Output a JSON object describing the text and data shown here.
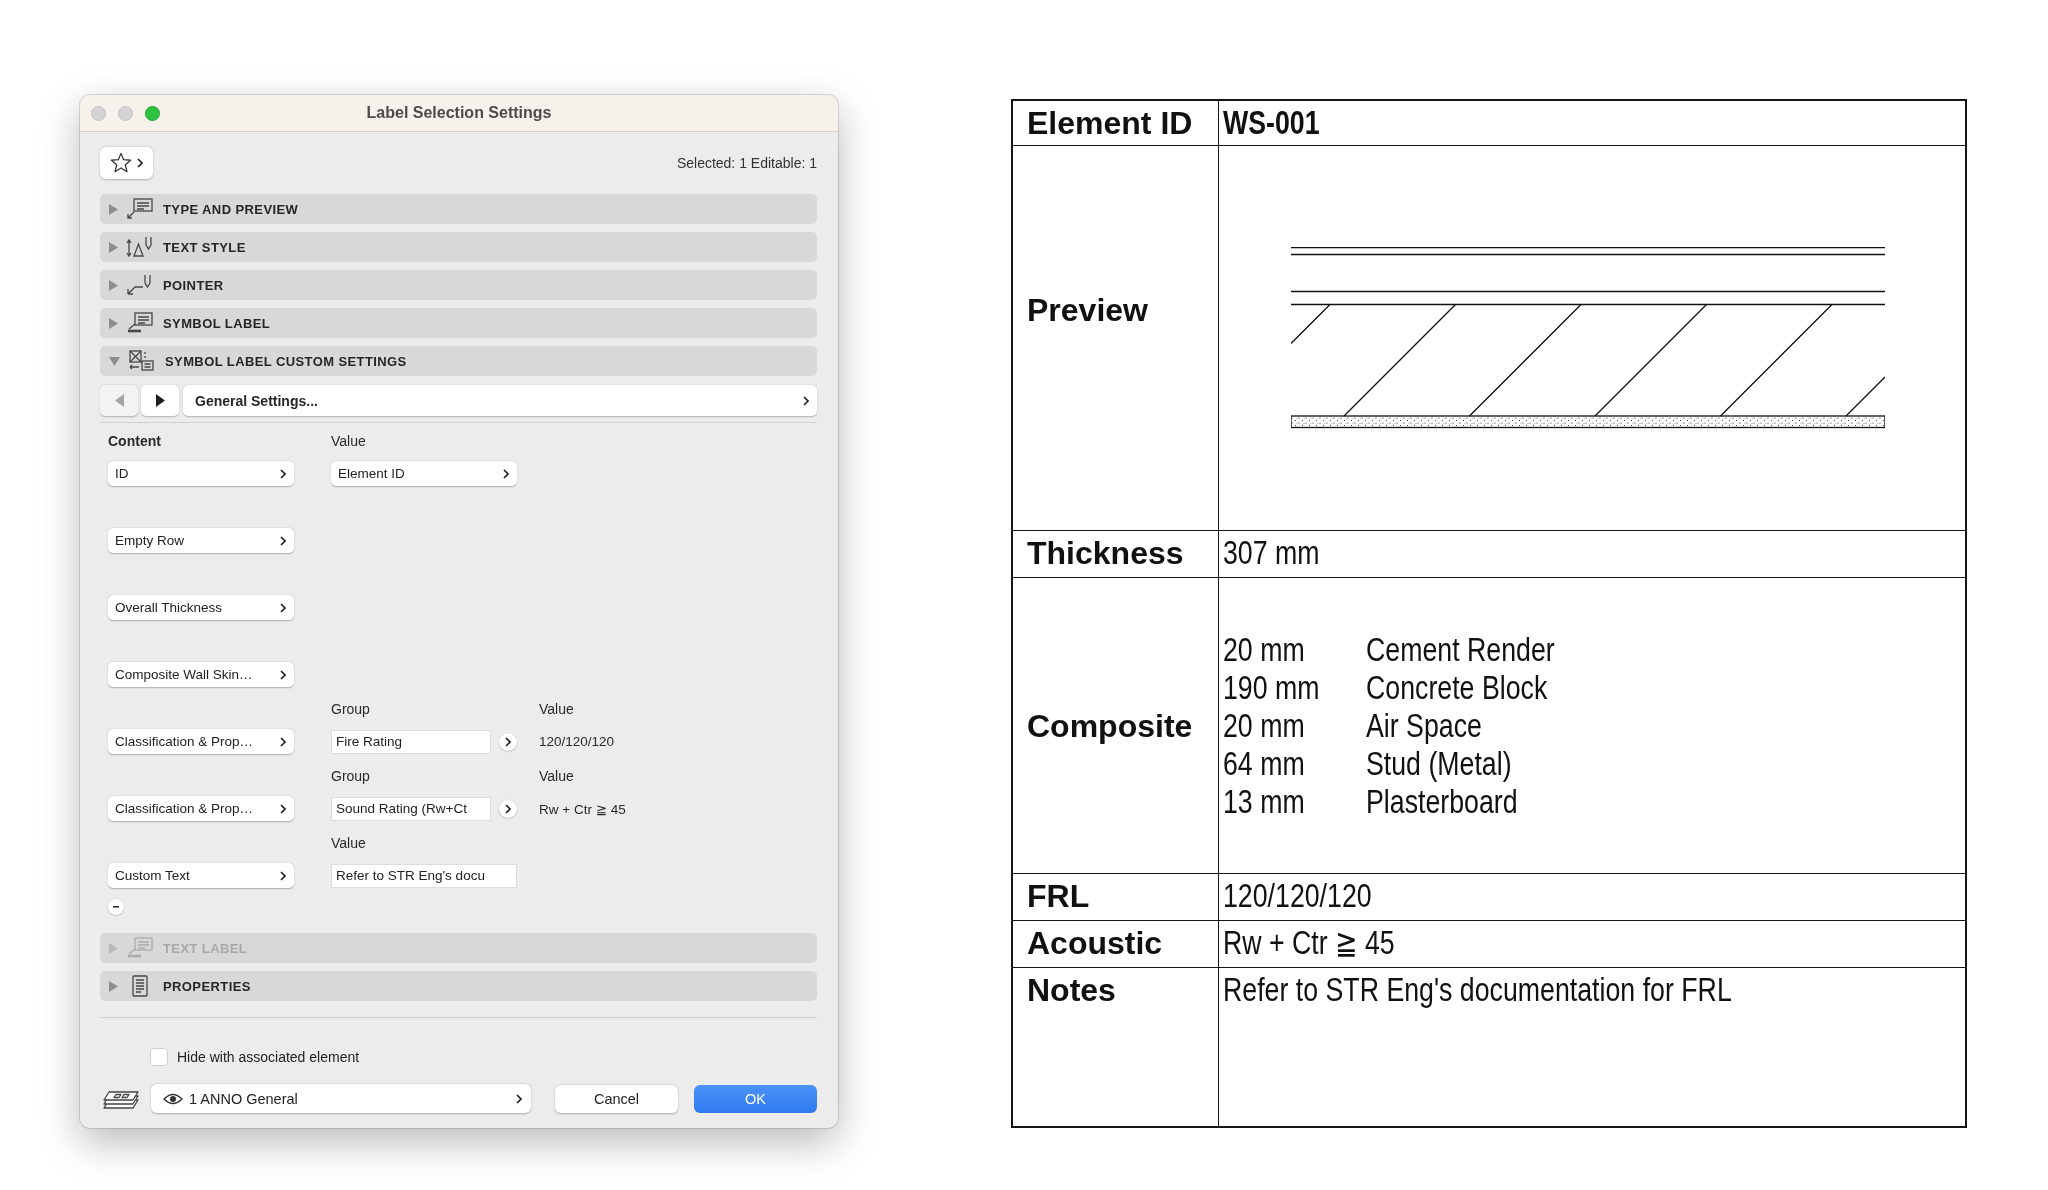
{
  "dialog": {
    "title": "Label Selection Settings",
    "window_buttons": [
      {
        "kind": "close",
        "disabled": true
      },
      {
        "kind": "minimize",
        "disabled": true
      },
      {
        "kind": "zoom",
        "disabled": false
      }
    ],
    "selection_info": "Selected: 1 Editable: 1",
    "sections": [
      {
        "kind": "preview",
        "label": "TYPE AND PREVIEW",
        "expanded": false,
        "disabled": false
      },
      {
        "kind": "style",
        "label": "TEXT STYLE",
        "expanded": false,
        "disabled": false
      },
      {
        "kind": "pointer",
        "label": "POINTER",
        "expanded": false,
        "disabled": false
      },
      {
        "kind": "symbol",
        "label": "SYMBOL LABEL",
        "expanded": false,
        "disabled": false
      },
      {
        "kind": "custom",
        "label": "SYMBOL LABEL CUSTOM SETTINGS",
        "expanded": true,
        "disabled": false,
        "panel": {
          "page": {
            "title": "General Settings...",
            "previous_disabled": true,
            "next_disabled": false
          },
          "rows": [
            {
              "kind": "choice",
              "content_caption": "Content",
              "value_caption": "Value",
              "content": "ID",
              "value": "Element ID"
            },
            {
              "kind": "plain",
              "content": "Empty Row"
            },
            {
              "kind": "plain",
              "content": "Overall Thickness"
            },
            {
              "kind": "plain",
              "content": "Composite Wall Skin…"
            },
            {
              "kind": "property",
              "group_caption": "Group",
              "value_caption": "Value",
              "content": "Classification & Prop…",
              "group": "Fire Rating",
              "value": "120/120/120"
            },
            {
              "kind": "property",
              "group_caption": "Group",
              "value_caption": "Value",
              "content": "Classification & Prop…",
              "group": "Sound Rating (Rw+Ct",
              "value": "Rw + Ctr ≧ 45"
            },
            {
              "kind": "text",
              "value_caption": "Value",
              "content": "Custom Text",
              "value": "Refer to STR Eng's docu"
            }
          ]
        }
      },
      {
        "kind": "symbol",
        "label": "TEXT LABEL",
        "expanded": false,
        "disabled": true
      },
      {
        "kind": "properties",
        "label": "PROPERTIES",
        "expanded": false,
        "disabled": false
      }
    ],
    "hide_option": {
      "label": "Hide with associated element",
      "checked": false
    },
    "layer": "1 ANNO General",
    "buttons": [
      {
        "kind": "secondary",
        "label": "Cancel"
      },
      {
        "kind": "primary",
        "label": "OK"
      }
    ]
  },
  "label_table": {
    "rows": [
      {
        "kind": "title",
        "heading": "Element ID",
        "value": "WS-001"
      },
      {
        "kind": "preview",
        "heading": "Preview"
      },
      {
        "kind": "text",
        "heading": "Thickness",
        "value": "307 mm"
      },
      {
        "kind": "layers",
        "heading": "Composite",
        "layers": [
          {
            "thickness": "20 mm",
            "material": "Cement Render"
          },
          {
            "thickness": "190 mm",
            "material": "Concrete Block"
          },
          {
            "thickness": "20 mm",
            "material": "Air Space"
          },
          {
            "thickness": "64 mm",
            "material": "Stud (Metal)"
          },
          {
            "thickness": "13 mm",
            "material": "Plasterboard"
          }
        ]
      },
      {
        "kind": "text",
        "heading": "FRL",
        "value": "120/120/120"
      },
      {
        "kind": "text",
        "heading": "Acoustic",
        "value": "Rw + Ctr ≧ 45"
      },
      {
        "kind": "text",
        "heading": "Notes",
        "value": "Refer to STR Eng's documentation for FRL"
      }
    ]
  }
}
